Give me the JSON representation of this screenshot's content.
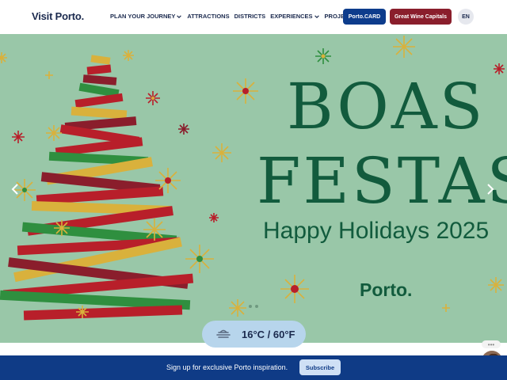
{
  "header": {
    "logo": "Visit Porto.",
    "nav": [
      {
        "label": "PLAN YOUR JOURNEY",
        "has_dropdown": true
      },
      {
        "label": "ATTRACTIONS",
        "has_dropdown": false
      },
      {
        "label": "DISTRICTS",
        "has_dropdown": false
      },
      {
        "label": "EXPERIENCES",
        "has_dropdown": true
      },
      {
        "label": "PROJECTS",
        "has_dropdown": true
      }
    ],
    "card_button": "Porto.CARD",
    "wine_button": "Great Wine Capitals",
    "language": "EN"
  },
  "hero": {
    "title_line1": "BOAS",
    "title_line2": "FESTAS",
    "subtitle": "Happy Holidays 2025",
    "brand": "Porto.",
    "slide_count": 2,
    "prev_icon": "chevron-left-icon",
    "next_icon": "chevron-right-icon",
    "colors": {
      "background": "#99c7a8",
      "title": "#125b3d",
      "tree_red": "#b81f2a",
      "tree_dark_red": "#8a1e2c",
      "tree_green": "#2f8f3f",
      "tree_gold": "#d9b13c"
    }
  },
  "weather": {
    "icon": "fog-icon",
    "text": "16°C / 60°F"
  },
  "signup": {
    "text": "Sign up for exclusive Porto inspiration.",
    "button": "Subscribe"
  },
  "chat": {
    "icon": "ellipsis-icon",
    "avatar": "assistant-avatar"
  }
}
